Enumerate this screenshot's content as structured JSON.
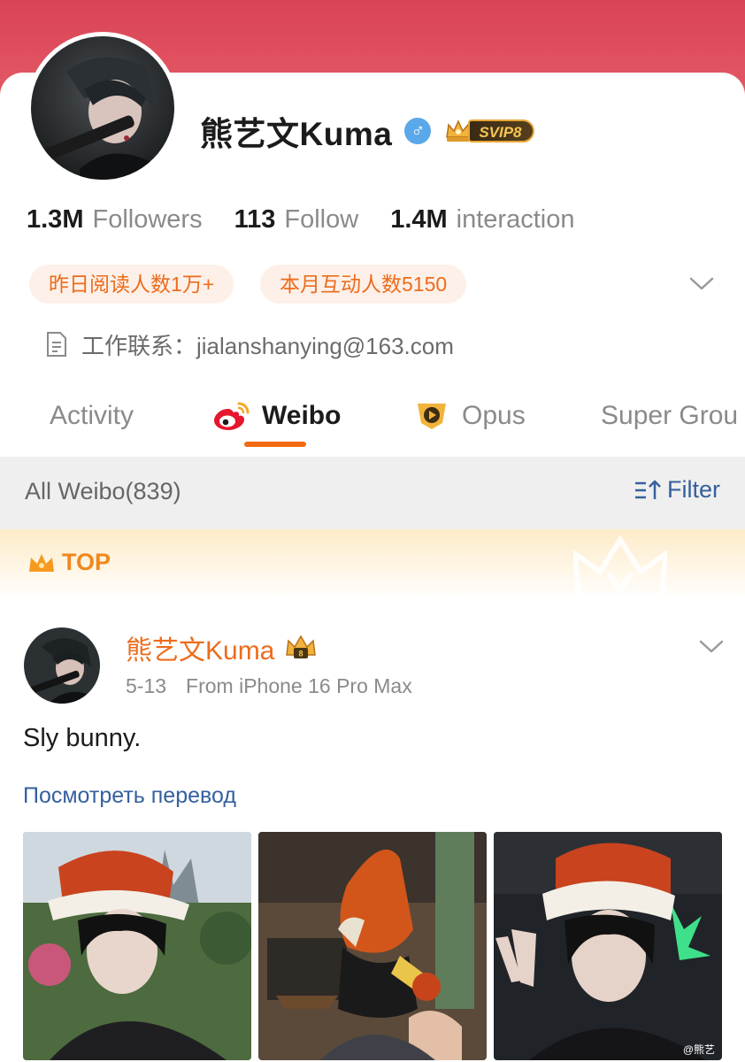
{
  "profile": {
    "name": "熊艺文Kuma",
    "gender_symbol": "♂",
    "vip_label": "SVIP8",
    "stats": [
      {
        "value": "1.3M",
        "label": "Followers"
      },
      {
        "value": "113",
        "label": "Follow"
      },
      {
        "value": "1.4M",
        "label": "interaction"
      }
    ],
    "pills": [
      "昨日阅读人数1万+",
      "本月互动人数5150"
    ],
    "contact": "工作联系：jialanshanying@163.com"
  },
  "tabs": [
    {
      "label": "Activity",
      "icon": "none",
      "active": false
    },
    {
      "label": "Weibo",
      "icon": "weibo-logo-icon",
      "active": true
    },
    {
      "label": "Opus",
      "icon": "opus-play-icon",
      "active": false
    },
    {
      "label": "Super Grou",
      "icon": "none",
      "active": false
    }
  ],
  "feed": {
    "count_label": "All Weibo(839)",
    "filter_label": "Filter",
    "top_label": "TOP"
  },
  "post": {
    "author": "熊艺文Kuma",
    "date": "5-13",
    "source": "From iPhone 16 Pro Max",
    "text": "Sly bunny.",
    "translate_label": "Посмотреть перевод",
    "watermark": "@熊艺"
  },
  "colors": {
    "banner": "#e04b5c",
    "accent": "#ec6c1d",
    "link": "#35609e",
    "tab_underline": "#f26b12"
  }
}
